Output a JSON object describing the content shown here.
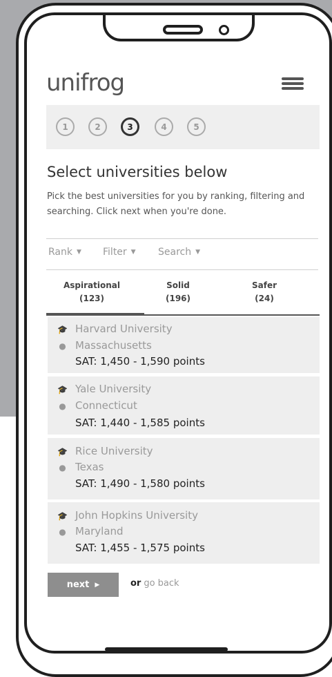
{
  "app": {
    "logo": "unifrog",
    "menu_icon": "hamburger-menu-icon"
  },
  "steps": [
    "1",
    "2",
    "3",
    "4",
    "5"
  ],
  "active_step": 3,
  "heading": "Select universities below",
  "intro": "Pick the best universities for you by ranking, filtering and searching. Click next when you're done.",
  "controls": {
    "rank": "Rank",
    "filter": "Filter",
    "search": "Search"
  },
  "tabs": [
    {
      "label": "Aspirational",
      "count": "(123)"
    },
    {
      "label": "Solid",
      "count": "(196)"
    },
    {
      "label": "Safer",
      "count": "(24)"
    }
  ],
  "universities": [
    {
      "name": "Harvard University",
      "state": "Massachusetts",
      "sat": "SAT: 1,450 - 1,590 points"
    },
    {
      "name": "Yale University",
      "state": "Connecticut",
      "sat": "SAT: 1,440 - 1,585 points"
    },
    {
      "name": "Rice University",
      "state": "Texas",
      "sat": "SAT: 1,490 - 1,580 points"
    },
    {
      "name": "John Hopkins University",
      "state": "Maryland",
      "sat": "SAT: 1,455 - 1,575 points"
    }
  ],
  "footer": {
    "next": "next",
    "or": "or",
    "back": "go back"
  },
  "colors": {
    "panel": "#eeeeee",
    "button": "#8e8e8e",
    "frame": "#1f1f1f",
    "backdrop": "#a9aaad"
  }
}
